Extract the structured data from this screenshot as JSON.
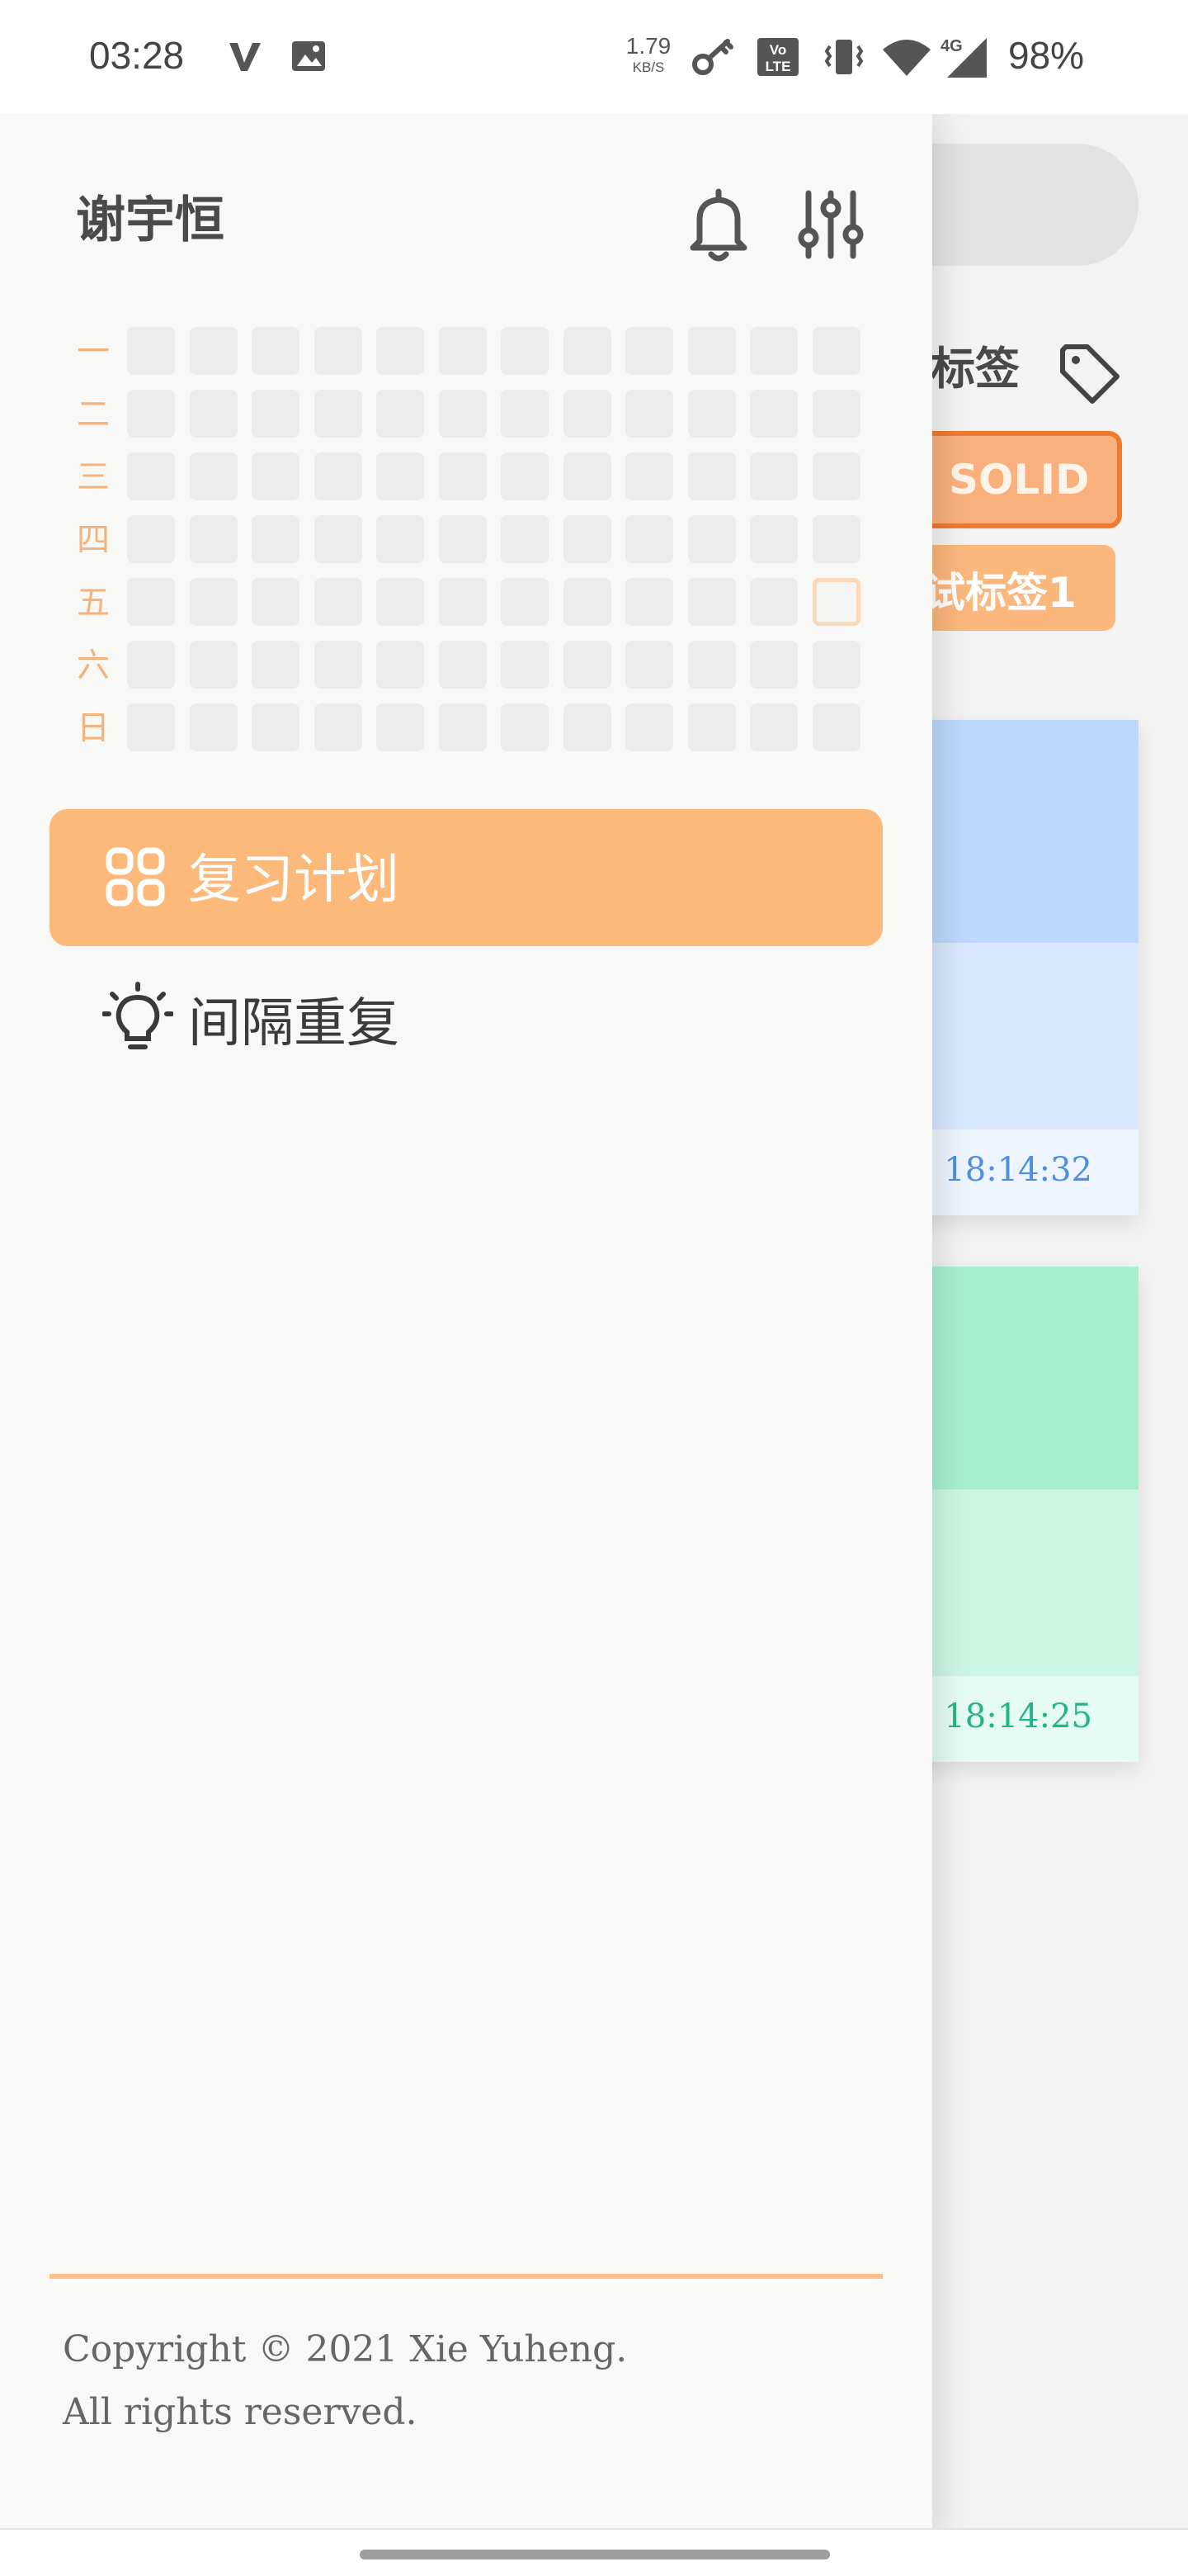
{
  "status_bar": {
    "time": "03:28",
    "net_speed_value": "1.79",
    "net_speed_unit": "KB/S",
    "battery": "98%",
    "icons": [
      "v-notification-icon",
      "image-notification-icon",
      "key-icon",
      "volte-icon",
      "vibrate-icon",
      "wifi-icon",
      "signal-4g-icon",
      "battery-percent"
    ],
    "volte_text": "Vo LTE",
    "network_type": "4G"
  },
  "drawer": {
    "user_name": "谢宇恒",
    "header_icons": [
      "bell-icon",
      "tune-icon"
    ],
    "heatmap": {
      "day_labels": [
        "一",
        "二",
        "三",
        "四",
        "五",
        "六",
        "日"
      ],
      "weeks": 12,
      "highlighted": {
        "day": "五",
        "week": 12
      },
      "label_color": "#f5b27a"
    },
    "menu": [
      {
        "label": "复习计划",
        "icon": "grid-icon",
        "active": true
      },
      {
        "label": "间隔重复",
        "icon": "lightbulb-icon",
        "active": false
      }
    ],
    "accent_color": "#fcb97a",
    "copyright_line1": "Copyright © 2021 Xie Yuheng.",
    "copyright_line2": "All rights reserved."
  },
  "background": {
    "tags_title": "标签",
    "tag_solid": "SOLID",
    "tag_test": "试标签1",
    "cards": [
      {
        "time": ") 18:14:32",
        "color": "#bcd8fb"
      },
      {
        "time": ") 18:14:25",
        "color": "#a8efd0"
      }
    ]
  }
}
